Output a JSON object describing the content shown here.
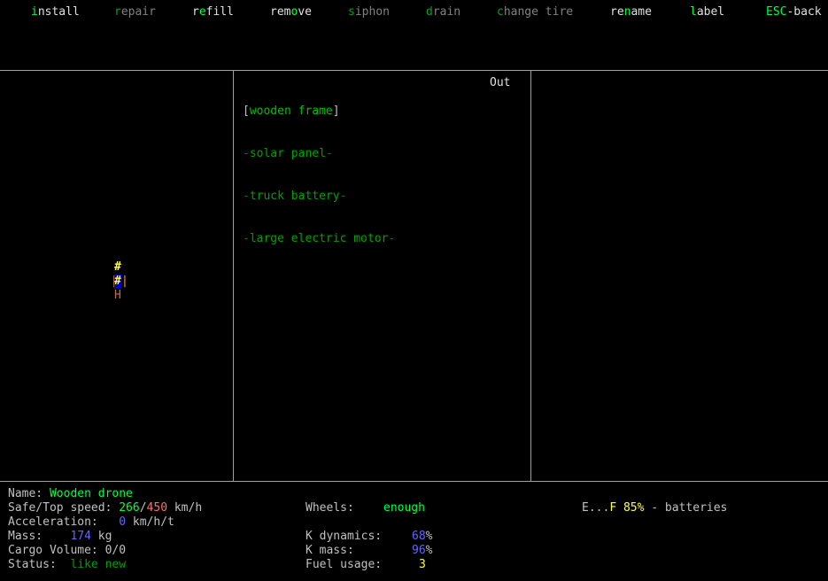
{
  "menu": {
    "install": {
      "key": "i",
      "rest": "nstall"
    },
    "repair": {
      "key": "r",
      "rest": "epair"
    },
    "refill": {
      "pre": "r",
      "key": "e",
      "rest": "fill"
    },
    "remove": {
      "pre": "rem",
      "key": "o",
      "rest": "ve"
    },
    "siphon": {
      "key": "s",
      "rest": "iphon"
    },
    "drain": {
      "key": "d",
      "rest": "rain"
    },
    "change_tire": {
      "key": "c",
      "rest": "hange tire"
    },
    "rename": {
      "pre": "re",
      "key": "n",
      "rest": "ame"
    },
    "label": {
      "key": "l",
      "rest": "abel"
    },
    "back": {
      "key": "ESC",
      "rest": "-back"
    }
  },
  "parts_panel": {
    "header_right": "Out",
    "parts": [
      {
        "prefix": "[",
        "name": "wooden frame",
        "suffix": "]"
      },
      {
        "prefix": "-",
        "name": "solar panel",
        "suffix": "-"
      },
      {
        "prefix": "-",
        "name": "truck battery",
        "suffix": "-"
      },
      {
        "prefix": "-",
        "name": "large electric motor",
        "suffix": "-"
      }
    ]
  },
  "vehicle_map": {
    "top_glyph": "#",
    "center_glyph": "#",
    "left_wall": "|",
    "right_wall": "|",
    "bottom_glyph": "H"
  },
  "stats": {
    "name_label": "Name:",
    "name_value": "Wooden drone",
    "speed_label": "Safe/Top speed:",
    "safe_speed": "266",
    "slash": "/",
    "top_speed": "450",
    "speed_unit": "km/h",
    "accel_label": "Acceleration:",
    "accel_value": "0",
    "accel_unit": "km/h/t",
    "mass_label": "Mass:",
    "mass_value": "174",
    "mass_unit": "kg",
    "cargo_label": "Cargo Volume:",
    "cargo_value": "0/0",
    "status_label": "Status:",
    "status_value": "like new",
    "wheels_label": "Wheels:",
    "wheels_value": "enough",
    "kdyn_label": "K dynamics:",
    "kdyn_value": "68",
    "kmass_label": "K mass:",
    "kmass_value": "96",
    "percent": "%",
    "fuel_label": "Fuel usage:",
    "fuel_value": "3",
    "fuel_gauge_left": "E...",
    "fuel_gauge_right": "F",
    "fuel_percent": "85%",
    "fuel_type": " - batteries"
  },
  "colors": {
    "hotkey": "#00ff40",
    "border": "#a0a0a0",
    "part_name": "#00a000"
  }
}
